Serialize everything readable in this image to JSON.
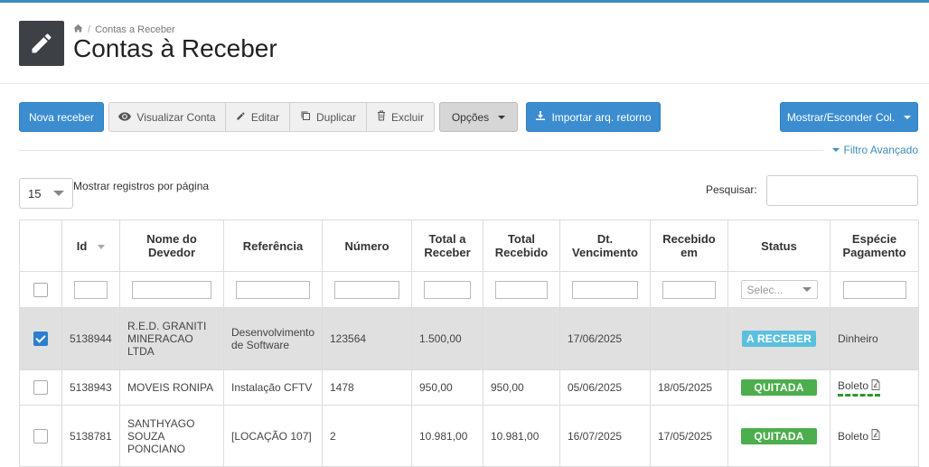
{
  "breadcrumb": {
    "current": "Contas a Receber"
  },
  "page_title": "Contas à Receber",
  "toolbar": {
    "new": "Nova receber",
    "view": "Visualizar Conta",
    "edit": "Editar",
    "duplicate": "Duplicar",
    "delete": "Excluir",
    "options": "Opções",
    "import": "Importar arq. retorno",
    "toggle_cols": "Mostrar/Esconder Col."
  },
  "advanced_filter": "Filtro Avançado",
  "page_length": {
    "value": "15",
    "label": "Mostrar registros por página"
  },
  "search": {
    "label": "Pesquisar:",
    "value": ""
  },
  "table": {
    "headers": {
      "id": "Id",
      "devedor_1": "Nome do",
      "devedor_2": "Devedor",
      "referencia": "Referência",
      "numero": "Número",
      "total_receber_1": "Total a",
      "total_receber_2": "Receber",
      "total_recebido_1": "Total",
      "total_recebido_2": "Recebido",
      "vencimento_1": "Dt.",
      "vencimento_2": "Vencimento",
      "recebido_1": "Recebido",
      "recebido_2": "em",
      "status": "Status",
      "especie_1": "Espécie",
      "especie_2": "Pagamento"
    },
    "status_filter_placeholder": "Selec...",
    "rows": [
      {
        "id": "5138944",
        "devedor": [
          "R.E.D. GRANITI",
          "MINERACAO",
          "LTDA"
        ],
        "referencia": [
          "Desenvolvimento",
          "de Software"
        ],
        "numero": "123564",
        "total_receber": "1.500,00",
        "total_recebido": "",
        "vencimento": "17/06/2025",
        "recebido_em": "",
        "status": "A RECEBER",
        "especie": "Dinheiro"
      },
      {
        "id": "5138943",
        "devedor": [
          "MOVEIS RONIPA"
        ],
        "referencia": [
          "Instalação CFTV"
        ],
        "numero": "1478",
        "total_receber": "950,00",
        "total_recebido": "950,00",
        "vencimento": "05/06/2025",
        "recebido_em": "18/05/2025",
        "status": "QUITADA",
        "especie": "Boleto"
      },
      {
        "id": "5138781",
        "devedor": [
          "SANTHYAGO",
          "SOUZA",
          "PONCIANO"
        ],
        "referencia": [
          "[LOCAÇÃO 107]"
        ],
        "numero": "2",
        "total_receber": "10.981,00",
        "total_recebido": "10.981,00",
        "vencimento": "16/07/2025",
        "recebido_em": "17/05/2025",
        "status": "QUITADA",
        "especie": "Boleto"
      }
    ]
  },
  "colors": {
    "primary": "#3c8dd0",
    "badge_receber": "#5bc0de",
    "badge_quitada": "#4cae4c",
    "selected_row": "#e0e0e0"
  },
  "icons": [
    "pencil-icon",
    "home-icon",
    "eye-icon",
    "edit-icon",
    "copy-icon",
    "trash-icon",
    "download-icon",
    "pdf-icon"
  ]
}
